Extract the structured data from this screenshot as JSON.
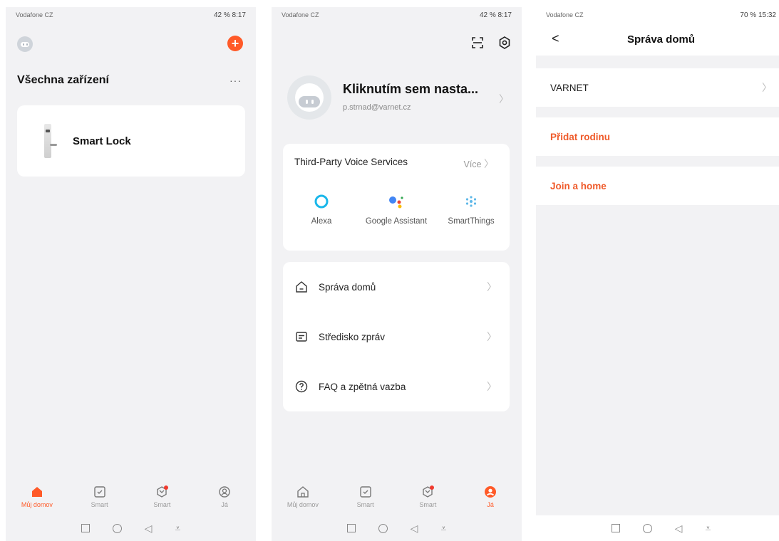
{
  "screen1": {
    "status": {
      "carrier": "Vodafone CZ",
      "right": "42 % 8:17"
    },
    "title": "Všechna zařízení",
    "more": "···",
    "add": "+",
    "device": {
      "name": "Smart Lock"
    },
    "tabs": [
      {
        "label": "Můj domov",
        "icon": "home-icon",
        "active": true
      },
      {
        "label": "Smart",
        "icon": "checkbox-icon",
        "active": false
      },
      {
        "label": "Smart",
        "icon": "scene-icon",
        "active": false
      },
      {
        "label": "Já",
        "icon": "profile-icon",
        "active": false
      }
    ]
  },
  "screen2": {
    "status": {
      "carrier": "Vodafone CZ",
      "right": "42 % 8:17"
    },
    "profile": {
      "name": "Kliknutím sem nasta...",
      "email": "p.strnad@varnet.cz"
    },
    "voice": {
      "title": "Third-Party Voice Services",
      "more": "Více",
      "services": [
        "Alexa",
        "Google Assistant",
        "SmartThings"
      ]
    },
    "menu": [
      {
        "label": "Správa domů",
        "icon": "house-icon"
      },
      {
        "label": "Středisko zpráv",
        "icon": "message-icon"
      },
      {
        "label": "FAQ a zpětná vazba",
        "icon": "help-icon"
      }
    ],
    "tabs": [
      {
        "label": "Můj domov",
        "icon": "home-icon",
        "active": false
      },
      {
        "label": "Smart",
        "icon": "checkbox-icon",
        "active": false
      },
      {
        "label": "Smart",
        "icon": "scene-icon",
        "active": false
      },
      {
        "label": "Já",
        "icon": "profile-icon",
        "active": true
      }
    ]
  },
  "screen3": {
    "status": {
      "carrier": "Vodafone CZ",
      "right": "70 % 15:32"
    },
    "title": "Správa domů",
    "home_name": "VARNET",
    "add_family": "Přidat rodinu",
    "join_home": "Join a home"
  },
  "colors": {
    "accent": "#ff5a28",
    "background": "#f2f2f4",
    "card": "#ffffff"
  }
}
